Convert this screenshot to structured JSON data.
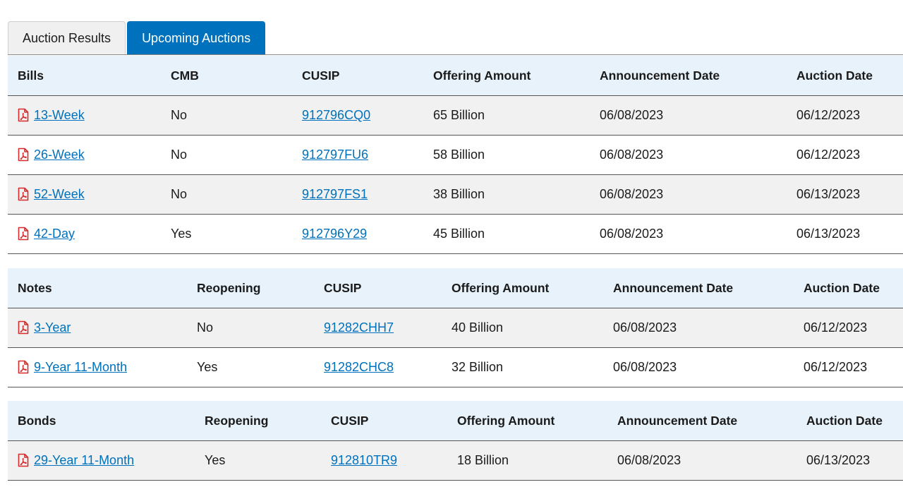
{
  "tabs": [
    {
      "label": "Auction Results",
      "active": false
    },
    {
      "label": "Upcoming Auctions",
      "active": true
    }
  ],
  "colors": {
    "accent": "#0071bc",
    "header_bg": "#e7f2fb",
    "pdf_icon": "#d62b2b"
  },
  "bills": {
    "headers": [
      "Bills",
      "CMB",
      "CUSIP",
      "Offering Amount",
      "Announcement Date",
      "Auction Date"
    ],
    "rows": [
      {
        "security": "13-Week",
        "flag": "No",
        "cusip": "912796CQ0",
        "amount": "65 Billion",
        "announcement": "06/08/2023",
        "auction": "06/12/2023"
      },
      {
        "security": "26-Week",
        "flag": "No",
        "cusip": "912797FU6",
        "amount": "58 Billion",
        "announcement": "06/08/2023",
        "auction": "06/12/2023"
      },
      {
        "security": "52-Week",
        "flag": "No",
        "cusip": "912797FS1",
        "amount": "38 Billion",
        "announcement": "06/08/2023",
        "auction": "06/13/2023"
      },
      {
        "security": "42-Day",
        "flag": "Yes",
        "cusip": "912796Y29",
        "amount": "45 Billion",
        "announcement": "06/08/2023",
        "auction": "06/13/2023"
      }
    ]
  },
  "notes": {
    "headers": [
      "Notes",
      "Reopening",
      "CUSIP",
      "Offering Amount",
      "Announcement Date",
      "Auction Date"
    ],
    "rows": [
      {
        "security": "3-Year",
        "flag": "No",
        "cusip": "91282CHH7",
        "amount": "40 Billion",
        "announcement": "06/08/2023",
        "auction": "06/12/2023"
      },
      {
        "security": "9-Year 11-Month",
        "flag": "Yes",
        "cusip": "91282CHC8",
        "amount": "32 Billion",
        "announcement": "06/08/2023",
        "auction": "06/12/2023"
      }
    ]
  },
  "bonds": {
    "headers": [
      "Bonds",
      "Reopening",
      "CUSIP",
      "Offering Amount",
      "Announcement Date",
      "Auction Date"
    ],
    "rows": [
      {
        "security": "29-Year 11-Month",
        "flag": "Yes",
        "cusip": "912810TR9",
        "amount": "18 Billion",
        "announcement": "06/08/2023",
        "auction": "06/13/2023"
      }
    ]
  }
}
